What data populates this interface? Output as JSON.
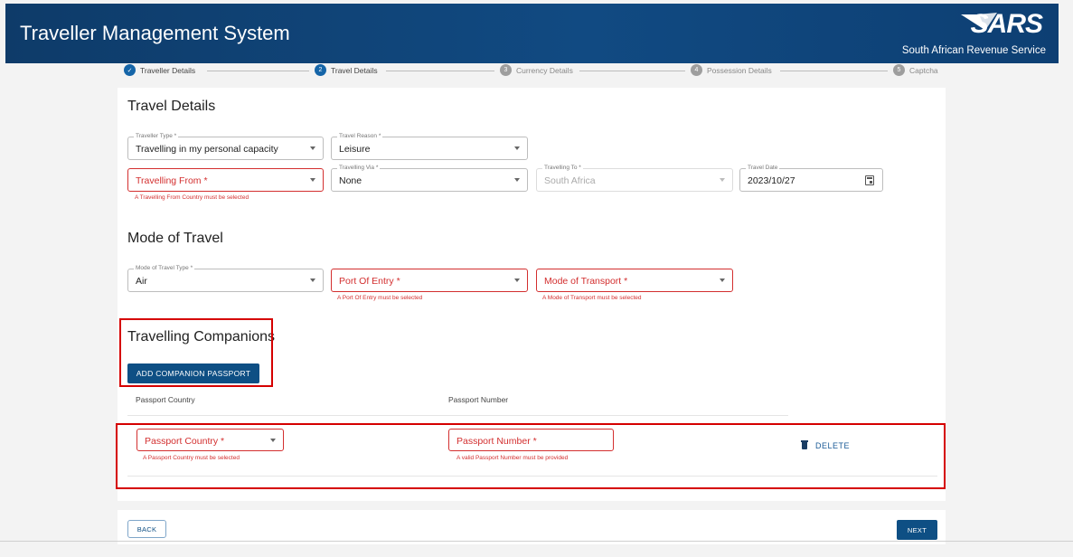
{
  "header": {
    "title": "Traveller Management System",
    "brand": "SARS",
    "brand_subtitle": "South African Revenue Service"
  },
  "stepper": [
    {
      "number": "✓",
      "label": "Traveller Details",
      "state": "done"
    },
    {
      "number": "2",
      "label": "Travel Details",
      "state": "active"
    },
    {
      "number": "3",
      "label": "Currency Details",
      "state": "pending"
    },
    {
      "number": "4",
      "label": "Possession Details",
      "state": "pending"
    },
    {
      "number": "5",
      "label": "Captcha",
      "state": "pending"
    }
  ],
  "travel_details": {
    "title": "Travel Details",
    "traveller_type": {
      "label": "Traveller Type *",
      "value": "Travelling in my personal capacity"
    },
    "travel_reason": {
      "label": "Travel Reason *",
      "value": "Leisure"
    },
    "travelling_from": {
      "placeholder": "Travelling From *",
      "error": "A Travelling From Country must be selected"
    },
    "travelling_via": {
      "label": "Travelling Via *",
      "value": "None"
    },
    "travelling_to": {
      "label": "Travelling To *",
      "value": "South Africa"
    },
    "travel_date": {
      "label": "Travel Date",
      "value": "2023/10/27"
    }
  },
  "mode_of_travel": {
    "title": "Mode of Travel",
    "type": {
      "label": "Mode of Travel Type *",
      "value": "Air"
    },
    "port_of_entry": {
      "placeholder": "Port Of Entry *",
      "error": "A Port Of Entry must be selected"
    },
    "mode_of_transport": {
      "placeholder": "Mode of Transport *",
      "error": "A Mode of Transport must be selected"
    }
  },
  "companions": {
    "title": "Travelling Companions",
    "add_button": "ADD COMPANION PASSPORT",
    "col_country": "Passport Country",
    "col_number": "Passport Number",
    "row": {
      "country_placeholder": "Passport Country *",
      "country_error": "A Passport Country must be selected",
      "number_placeholder": "Passport Number *",
      "number_error": "A valid Passport Number must be provided",
      "delete_label": "DELETE"
    }
  },
  "footer": {
    "back": "BACK",
    "next": "NEXT"
  },
  "colors": {
    "header": "#114a82",
    "primary": "#0e4f84",
    "error": "#d32f2f",
    "highlight": "#d50000"
  }
}
